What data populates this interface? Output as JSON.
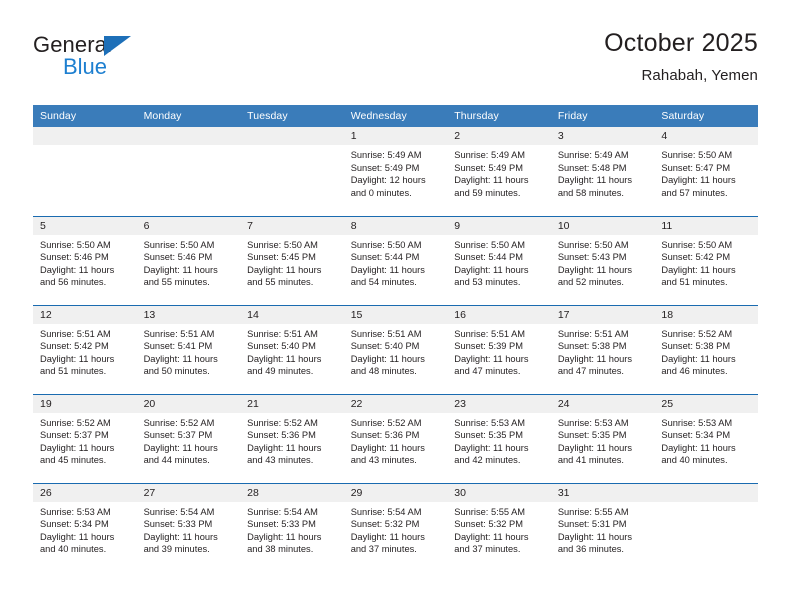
{
  "brand": {
    "name_dark": "General",
    "name_blue": "Blue"
  },
  "header": {
    "title": "October 2025",
    "location": "Rahabah, Yemen"
  },
  "colors": {
    "header_blue": "#3a7cba",
    "rule_blue": "#1a6bb0",
    "band_gray": "#f0f0f0",
    "logo_blue": "#1d7fd0",
    "text": "#231f20"
  },
  "weekday_headers": [
    "Sunday",
    "Monday",
    "Tuesday",
    "Wednesday",
    "Thursday",
    "Friday",
    "Saturday"
  ],
  "weeks": [
    [
      {
        "day": "",
        "sunrise": "",
        "sunset": "",
        "daylight_a": "",
        "daylight_b": ""
      },
      {
        "day": "",
        "sunrise": "",
        "sunset": "",
        "daylight_a": "",
        "daylight_b": ""
      },
      {
        "day": "",
        "sunrise": "",
        "sunset": "",
        "daylight_a": "",
        "daylight_b": ""
      },
      {
        "day": "1",
        "sunrise": "Sunrise: 5:49 AM",
        "sunset": "Sunset: 5:49 PM",
        "daylight_a": "Daylight: 12 hours",
        "daylight_b": "and 0 minutes."
      },
      {
        "day": "2",
        "sunrise": "Sunrise: 5:49 AM",
        "sunset": "Sunset: 5:49 PM",
        "daylight_a": "Daylight: 11 hours",
        "daylight_b": "and 59 minutes."
      },
      {
        "day": "3",
        "sunrise": "Sunrise: 5:49 AM",
        "sunset": "Sunset: 5:48 PM",
        "daylight_a": "Daylight: 11 hours",
        "daylight_b": "and 58 minutes."
      },
      {
        "day": "4",
        "sunrise": "Sunrise: 5:50 AM",
        "sunset": "Sunset: 5:47 PM",
        "daylight_a": "Daylight: 11 hours",
        "daylight_b": "and 57 minutes."
      }
    ],
    [
      {
        "day": "5",
        "sunrise": "Sunrise: 5:50 AM",
        "sunset": "Sunset: 5:46 PM",
        "daylight_a": "Daylight: 11 hours",
        "daylight_b": "and 56 minutes."
      },
      {
        "day": "6",
        "sunrise": "Sunrise: 5:50 AM",
        "sunset": "Sunset: 5:46 PM",
        "daylight_a": "Daylight: 11 hours",
        "daylight_b": "and 55 minutes."
      },
      {
        "day": "7",
        "sunrise": "Sunrise: 5:50 AM",
        "sunset": "Sunset: 5:45 PM",
        "daylight_a": "Daylight: 11 hours",
        "daylight_b": "and 55 minutes."
      },
      {
        "day": "8",
        "sunrise": "Sunrise: 5:50 AM",
        "sunset": "Sunset: 5:44 PM",
        "daylight_a": "Daylight: 11 hours",
        "daylight_b": "and 54 minutes."
      },
      {
        "day": "9",
        "sunrise": "Sunrise: 5:50 AM",
        "sunset": "Sunset: 5:44 PM",
        "daylight_a": "Daylight: 11 hours",
        "daylight_b": "and 53 minutes."
      },
      {
        "day": "10",
        "sunrise": "Sunrise: 5:50 AM",
        "sunset": "Sunset: 5:43 PM",
        "daylight_a": "Daylight: 11 hours",
        "daylight_b": "and 52 minutes."
      },
      {
        "day": "11",
        "sunrise": "Sunrise: 5:50 AM",
        "sunset": "Sunset: 5:42 PM",
        "daylight_a": "Daylight: 11 hours",
        "daylight_b": "and 51 minutes."
      }
    ],
    [
      {
        "day": "12",
        "sunrise": "Sunrise: 5:51 AM",
        "sunset": "Sunset: 5:42 PM",
        "daylight_a": "Daylight: 11 hours",
        "daylight_b": "and 51 minutes."
      },
      {
        "day": "13",
        "sunrise": "Sunrise: 5:51 AM",
        "sunset": "Sunset: 5:41 PM",
        "daylight_a": "Daylight: 11 hours",
        "daylight_b": "and 50 minutes."
      },
      {
        "day": "14",
        "sunrise": "Sunrise: 5:51 AM",
        "sunset": "Sunset: 5:40 PM",
        "daylight_a": "Daylight: 11 hours",
        "daylight_b": "and 49 minutes."
      },
      {
        "day": "15",
        "sunrise": "Sunrise: 5:51 AM",
        "sunset": "Sunset: 5:40 PM",
        "daylight_a": "Daylight: 11 hours",
        "daylight_b": "and 48 minutes."
      },
      {
        "day": "16",
        "sunrise": "Sunrise: 5:51 AM",
        "sunset": "Sunset: 5:39 PM",
        "daylight_a": "Daylight: 11 hours",
        "daylight_b": "and 47 minutes."
      },
      {
        "day": "17",
        "sunrise": "Sunrise: 5:51 AM",
        "sunset": "Sunset: 5:38 PM",
        "daylight_a": "Daylight: 11 hours",
        "daylight_b": "and 47 minutes."
      },
      {
        "day": "18",
        "sunrise": "Sunrise: 5:52 AM",
        "sunset": "Sunset: 5:38 PM",
        "daylight_a": "Daylight: 11 hours",
        "daylight_b": "and 46 minutes."
      }
    ],
    [
      {
        "day": "19",
        "sunrise": "Sunrise: 5:52 AM",
        "sunset": "Sunset: 5:37 PM",
        "daylight_a": "Daylight: 11 hours",
        "daylight_b": "and 45 minutes."
      },
      {
        "day": "20",
        "sunrise": "Sunrise: 5:52 AM",
        "sunset": "Sunset: 5:37 PM",
        "daylight_a": "Daylight: 11 hours",
        "daylight_b": "and 44 minutes."
      },
      {
        "day": "21",
        "sunrise": "Sunrise: 5:52 AM",
        "sunset": "Sunset: 5:36 PM",
        "daylight_a": "Daylight: 11 hours",
        "daylight_b": "and 43 minutes."
      },
      {
        "day": "22",
        "sunrise": "Sunrise: 5:52 AM",
        "sunset": "Sunset: 5:36 PM",
        "daylight_a": "Daylight: 11 hours",
        "daylight_b": "and 43 minutes."
      },
      {
        "day": "23",
        "sunrise": "Sunrise: 5:53 AM",
        "sunset": "Sunset: 5:35 PM",
        "daylight_a": "Daylight: 11 hours",
        "daylight_b": "and 42 minutes."
      },
      {
        "day": "24",
        "sunrise": "Sunrise: 5:53 AM",
        "sunset": "Sunset: 5:35 PM",
        "daylight_a": "Daylight: 11 hours",
        "daylight_b": "and 41 minutes."
      },
      {
        "day": "25",
        "sunrise": "Sunrise: 5:53 AM",
        "sunset": "Sunset: 5:34 PM",
        "daylight_a": "Daylight: 11 hours",
        "daylight_b": "and 40 minutes."
      }
    ],
    [
      {
        "day": "26",
        "sunrise": "Sunrise: 5:53 AM",
        "sunset": "Sunset: 5:34 PM",
        "daylight_a": "Daylight: 11 hours",
        "daylight_b": "and 40 minutes."
      },
      {
        "day": "27",
        "sunrise": "Sunrise: 5:54 AM",
        "sunset": "Sunset: 5:33 PM",
        "daylight_a": "Daylight: 11 hours",
        "daylight_b": "and 39 minutes."
      },
      {
        "day": "28",
        "sunrise": "Sunrise: 5:54 AM",
        "sunset": "Sunset: 5:33 PM",
        "daylight_a": "Daylight: 11 hours",
        "daylight_b": "and 38 minutes."
      },
      {
        "day": "29",
        "sunrise": "Sunrise: 5:54 AM",
        "sunset": "Sunset: 5:32 PM",
        "daylight_a": "Daylight: 11 hours",
        "daylight_b": "and 37 minutes."
      },
      {
        "day": "30",
        "sunrise": "Sunrise: 5:55 AM",
        "sunset": "Sunset: 5:32 PM",
        "daylight_a": "Daylight: 11 hours",
        "daylight_b": "and 37 minutes."
      },
      {
        "day": "31",
        "sunrise": "Sunrise: 5:55 AM",
        "sunset": "Sunset: 5:31 PM",
        "daylight_a": "Daylight: 11 hours",
        "daylight_b": "and 36 minutes."
      },
      {
        "day": "",
        "sunrise": "",
        "sunset": "",
        "daylight_a": "",
        "daylight_b": ""
      }
    ]
  ]
}
